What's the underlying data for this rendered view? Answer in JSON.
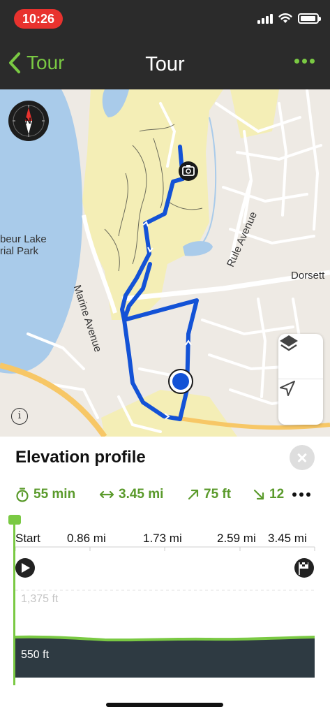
{
  "status_bar": {
    "time": "10:26"
  },
  "nav": {
    "back_label": "Tour",
    "title": "Tour"
  },
  "map": {
    "labels": {
      "lake_line1": "beur Lake",
      "lake_line2": "rial Park",
      "marine_ave": "Marine Avenue",
      "rule_ave": "Rule Avenue",
      "dorsett": "Dorsett"
    },
    "compass_letter": "N",
    "info_glyph": "i",
    "colors": {
      "route": "#1352d6",
      "water": "#a9cbea",
      "park": "#f4eeb6",
      "road": "#f7c766",
      "land": "#eeeae4"
    },
    "icons": [
      "compass-icon",
      "camera-icon",
      "layers-icon",
      "locate-arrow-icon",
      "info-icon"
    ]
  },
  "elevation_profile": {
    "title": "Elevation profile",
    "stats": {
      "duration": "55 min",
      "distance": "3.45 mi",
      "ascent": "75 ft",
      "descent": "12"
    },
    "distance_ticks": [
      "Start",
      "0.86 mi",
      "1.73 mi",
      "2.59 mi",
      "3.45 mi"
    ],
    "elevation_ticks": {
      "upper": "1,375 ft",
      "lower": "550 ft"
    },
    "colors": {
      "accent": "#7ac943",
      "stat_text": "#5a9a2b",
      "fill": "#2e3a42"
    }
  }
}
